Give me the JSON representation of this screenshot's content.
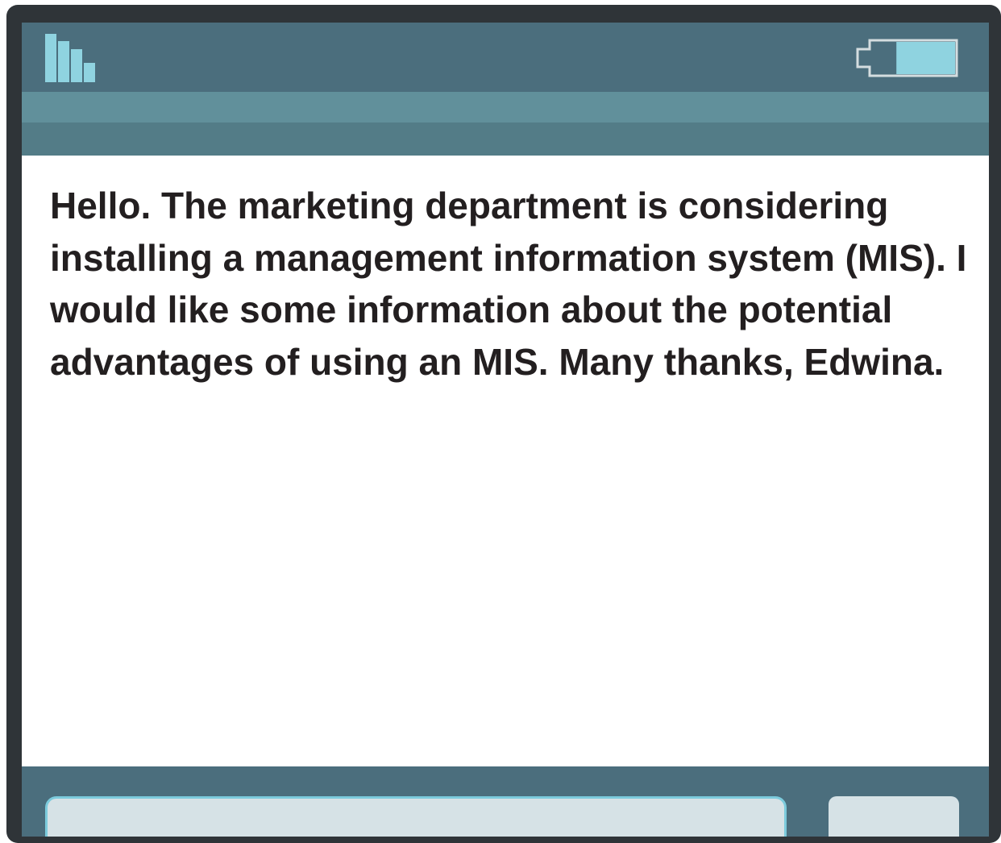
{
  "status_bar": {
    "signal_icon": "signal-strength-icon",
    "battery_icon": "battery-icon",
    "battery_level": 0.7
  },
  "message": {
    "text": "Hello. The marketing department is considering installing a management information system (MIS). I would like some information about the potential advantages of using an MIS. Many thanks, Edwina."
  },
  "colors": {
    "device_frame": "#2f3438",
    "header": "#4b6e7d",
    "band_light": "#61909b",
    "band_dark": "#537c87",
    "accent": "#8fd3e0",
    "input_bg": "#d6e2e6",
    "input_border": "#7ccbdc",
    "text": "#231f20"
  }
}
